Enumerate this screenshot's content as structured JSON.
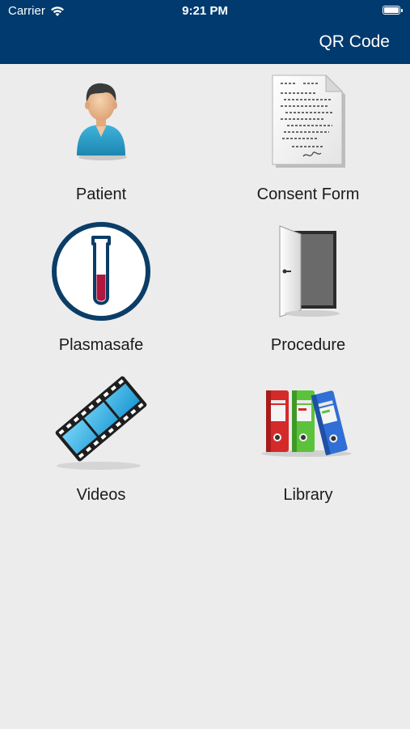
{
  "status_bar": {
    "carrier": "Carrier",
    "time": "9:21 PM"
  },
  "navbar": {
    "qr_label": "QR Code",
    "background_color": "#003a6e"
  },
  "tiles": [
    {
      "label": "Patient",
      "icon": "patient-icon"
    },
    {
      "label": "Consent Form",
      "icon": "consent-form-icon"
    },
    {
      "label": "Plasmasafe",
      "icon": "test-tube-icon"
    },
    {
      "label": "Procedure",
      "icon": "door-icon"
    },
    {
      "label": "Videos",
      "icon": "film-strip-icon"
    },
    {
      "label": "Library",
      "icon": "binders-icon"
    }
  ]
}
